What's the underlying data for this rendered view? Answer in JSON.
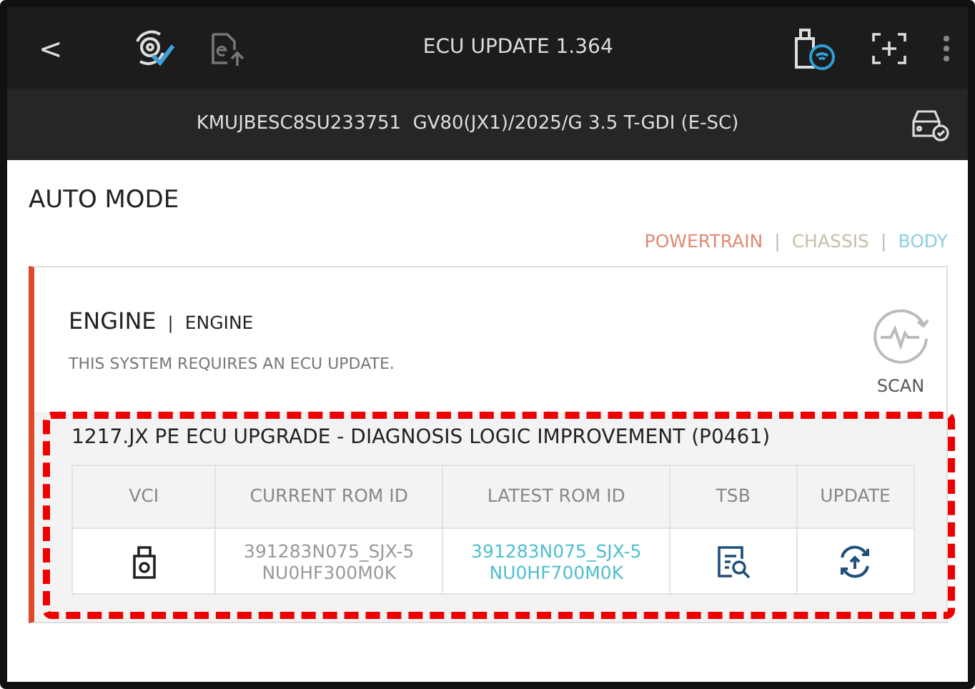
{
  "header": {
    "back": "<",
    "title": "ECU UPDATE 1.364"
  },
  "vehicle": {
    "vin": "KMUJBESC8SU233751",
    "model": "GV80(JX1)/2025/G 3.5 T-GDI (E-SC)"
  },
  "mode": {
    "title": "AUTO MODE"
  },
  "categories": {
    "separator": "|",
    "items": [
      {
        "label": "POWERTRAIN",
        "color": "#e08a74"
      },
      {
        "label": "CHASSIS",
        "color": "#c8bfa8"
      },
      {
        "label": "BODY",
        "color": "#8ccfe0"
      }
    ]
  },
  "system": {
    "name": "ENGINE",
    "separator": "|",
    "sub": "ENGINE",
    "message": "THIS SYSTEM REQUIRES AN ECU UPDATE.",
    "scan": "SCAN",
    "update": {
      "title": "1217.JX PE ECU UPGRADE - DIAGNOSIS LOGIC IMPROVEMENT (P0461)",
      "highlighted": true,
      "columns": [
        "VCI",
        "CURRENT ROM ID",
        "LATEST ROM ID",
        "TSB",
        "UPDATE"
      ],
      "current_rom": [
        "391283N075_SJX-5",
        "NU0HF300M0K"
      ],
      "latest_rom": [
        "391283N075_SJX-5",
        "NU0HF700M0K"
      ]
    }
  }
}
